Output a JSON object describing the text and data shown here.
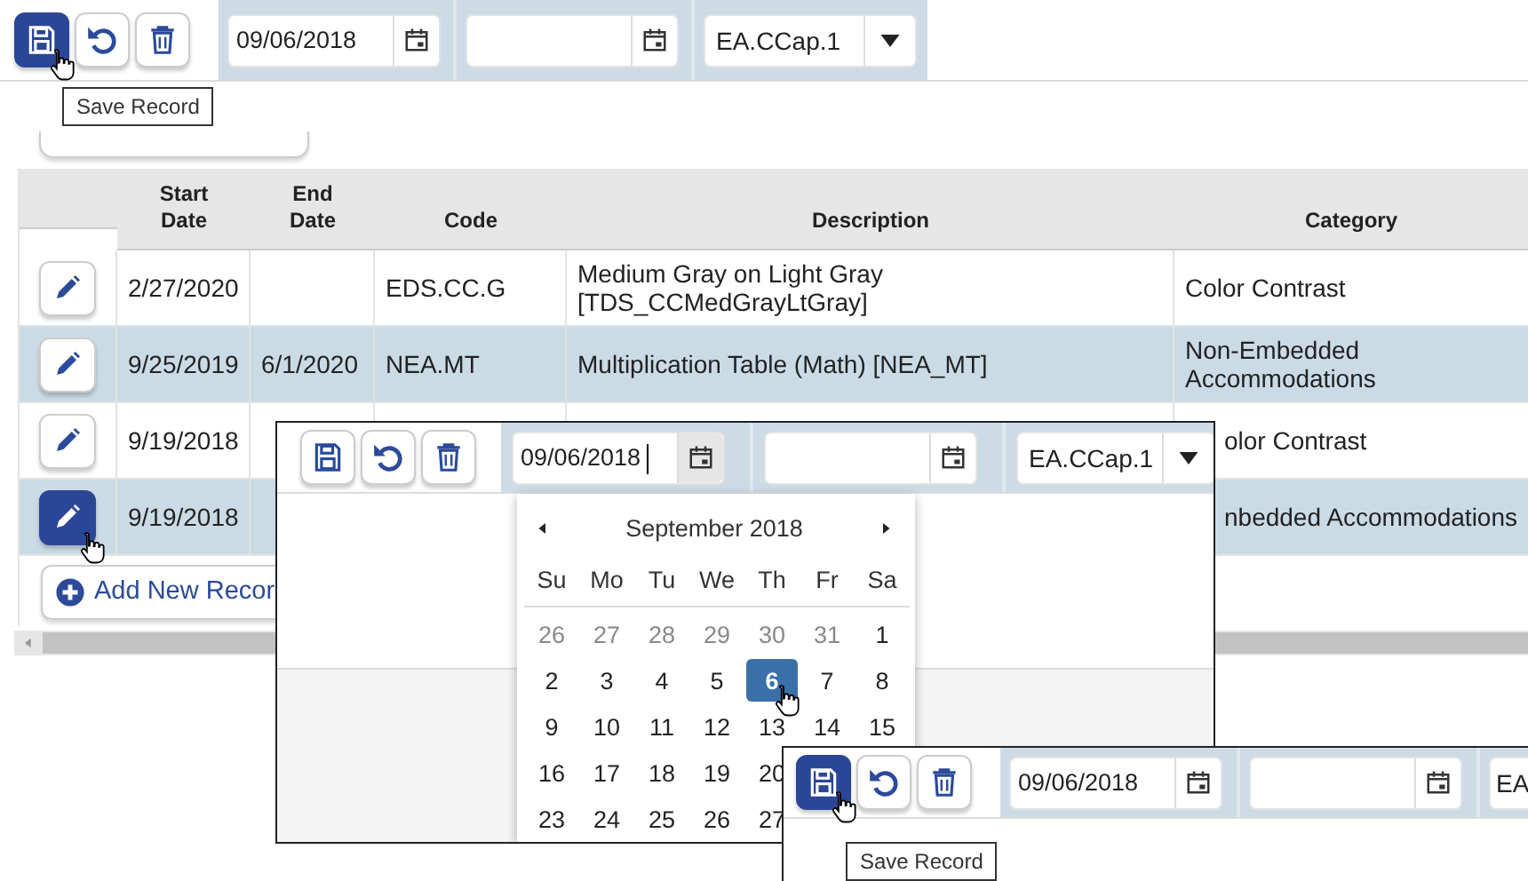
{
  "main": {
    "toolbar": {
      "buttons": [
        {
          "kind": "save",
          "pressed": true,
          "cursor": true
        },
        {
          "kind": "undo",
          "pressed": false,
          "cursor": false
        },
        {
          "kind": "delete",
          "pressed": false,
          "cursor": false
        }
      ],
      "date_fields": [
        {
          "value": "09/06/2018",
          "focused": false
        },
        {
          "focused": false
        }
      ],
      "select": {
        "value": "EA.CCap.1"
      }
    },
    "tooltip": "Save Record",
    "table": {
      "columns": [
        "Start Date",
        "End Date",
        "Code",
        "Description",
        "Category"
      ],
      "rows": [
        {
          "start": "2/27/2020",
          "code": "EDS.CC.G",
          "description": "Medium Gray on Light Gray [TDS_CCMedGrayLtGray]",
          "category": "Color Contrast",
          "selected": false,
          "edit_pressed": false,
          "cursor": false
        },
        {
          "start": "9/25/2019",
          "end": "6/1/2020",
          "code": "NEA.MT",
          "description": "Multiplication Table (Math) [NEA_MT]",
          "category": "Non-Embedded Accommodations",
          "selected": true,
          "edit_pressed": false,
          "cursor": false
        },
        {
          "start": "9/19/2018",
          "category": "olor Contrast",
          "selected": false,
          "edit_pressed": false,
          "cursor": false
        },
        {
          "start": "9/19/2018",
          "category": "nbedded Accommodations",
          "selected": true,
          "edit_pressed": true,
          "cursor": true
        }
      ]
    },
    "add_button": "Add New Recor"
  },
  "popup_view": {
    "toolbar": {
      "buttons": [
        {
          "kind": "save",
          "pressed": false,
          "cursor": false
        },
        {
          "kind": "undo",
          "pressed": false,
          "cursor": false
        },
        {
          "kind": "delete",
          "pressed": false,
          "cursor": false
        }
      ],
      "date_fields": [
        {
          "value": "09/06/2018",
          "focused": true
        },
        {
          "focused": false
        }
      ],
      "select": {
        "value": "EA.CCap.1"
      }
    },
    "calendar": {
      "month": "September 2018",
      "weekdays": [
        "Su",
        "Mo",
        "Tu",
        "We",
        "Th",
        "Fr",
        "Sa"
      ],
      "weeks": [
        [
          {
            "day": "26",
            "muted": true,
            "selected": false
          },
          {
            "day": "27",
            "muted": true,
            "selected": false
          },
          {
            "day": "28",
            "muted": true,
            "selected": false
          },
          {
            "day": "29",
            "muted": true,
            "selected": false
          },
          {
            "day": "30",
            "muted": true,
            "selected": false
          },
          {
            "day": "31",
            "muted": true,
            "selected": false
          },
          {
            "day": "1",
            "muted": false,
            "selected": false
          }
        ],
        [
          {
            "day": "2",
            "muted": false,
            "selected": false
          },
          {
            "day": "3",
            "muted": false,
            "selected": false
          },
          {
            "day": "4",
            "muted": false,
            "selected": false
          },
          {
            "day": "5",
            "muted": false,
            "selected": false
          },
          {
            "day": "6",
            "muted": false,
            "selected": true,
            "cursor": true
          },
          {
            "day": "7",
            "muted": false,
            "selected": false
          },
          {
            "day": "8",
            "muted": false,
            "selected": false
          }
        ],
        [
          {
            "day": "9",
            "muted": false,
            "selected": false
          },
          {
            "day": "10",
            "muted": false,
            "selected": false
          },
          {
            "day": "11",
            "muted": false,
            "selected": false
          },
          {
            "day": "12",
            "muted": false,
            "selected": false
          },
          {
            "day": "13",
            "muted": false,
            "selected": false
          },
          {
            "day": "14",
            "muted": false,
            "selected": false
          },
          {
            "day": "15",
            "muted": false,
            "selected": false
          }
        ],
        [
          {
            "day": "16",
            "muted": false,
            "selected": false
          },
          {
            "day": "17",
            "muted": false,
            "selected": false
          },
          {
            "day": "18",
            "muted": false,
            "selected": false
          },
          {
            "day": "19",
            "muted": false,
            "selected": false
          },
          {
            "day": "20",
            "muted": false,
            "selected": false
          }
        ],
        [
          {
            "day": "23",
            "muted": false,
            "selected": false
          },
          {
            "day": "24",
            "muted": false,
            "selected": false
          },
          {
            "day": "25",
            "muted": false,
            "selected": false
          },
          {
            "day": "26",
            "muted": false,
            "selected": false
          },
          {
            "day": "27",
            "muted": false,
            "selected": false
          }
        ]
      ]
    }
  },
  "bottom_view": {
    "toolbar": {
      "buttons": [
        {
          "kind": "save",
          "pressed": true,
          "cursor": true
        },
        {
          "kind": "undo",
          "pressed": false,
          "cursor": false
        },
        {
          "kind": "delete",
          "pressed": false,
          "cursor": false
        }
      ],
      "date_fields": [
        {
          "value": "09/06/2018",
          "focused": false
        },
        {
          "focused": false
        }
      ],
      "select": {
        "value": "EA"
      }
    },
    "tooltip": "Save Record"
  }
}
